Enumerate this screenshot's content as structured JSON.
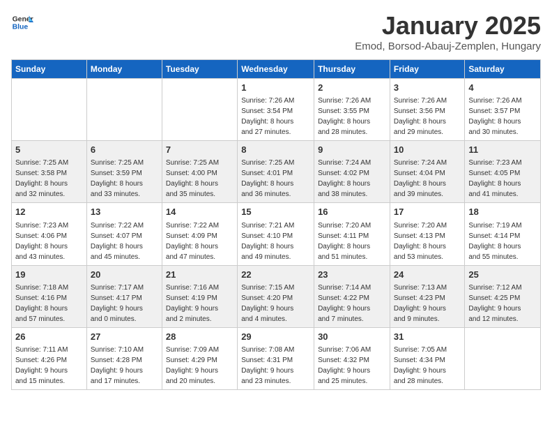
{
  "header": {
    "logo_general": "General",
    "logo_blue": "Blue",
    "month_title": "January 2025",
    "location": "Emod, Borsod-Abauj-Zemplen, Hungary"
  },
  "weekdays": [
    "Sunday",
    "Monday",
    "Tuesday",
    "Wednesday",
    "Thursday",
    "Friday",
    "Saturday"
  ],
  "weeks": [
    [
      {
        "day": "",
        "info": ""
      },
      {
        "day": "",
        "info": ""
      },
      {
        "day": "",
        "info": ""
      },
      {
        "day": "1",
        "info": "Sunrise: 7:26 AM\nSunset: 3:54 PM\nDaylight: 8 hours\nand 27 minutes."
      },
      {
        "day": "2",
        "info": "Sunrise: 7:26 AM\nSunset: 3:55 PM\nDaylight: 8 hours\nand 28 minutes."
      },
      {
        "day": "3",
        "info": "Sunrise: 7:26 AM\nSunset: 3:56 PM\nDaylight: 8 hours\nand 29 minutes."
      },
      {
        "day": "4",
        "info": "Sunrise: 7:26 AM\nSunset: 3:57 PM\nDaylight: 8 hours\nand 30 minutes."
      }
    ],
    [
      {
        "day": "5",
        "info": "Sunrise: 7:25 AM\nSunset: 3:58 PM\nDaylight: 8 hours\nand 32 minutes."
      },
      {
        "day": "6",
        "info": "Sunrise: 7:25 AM\nSunset: 3:59 PM\nDaylight: 8 hours\nand 33 minutes."
      },
      {
        "day": "7",
        "info": "Sunrise: 7:25 AM\nSunset: 4:00 PM\nDaylight: 8 hours\nand 35 minutes."
      },
      {
        "day": "8",
        "info": "Sunrise: 7:25 AM\nSunset: 4:01 PM\nDaylight: 8 hours\nand 36 minutes."
      },
      {
        "day": "9",
        "info": "Sunrise: 7:24 AM\nSunset: 4:02 PM\nDaylight: 8 hours\nand 38 minutes."
      },
      {
        "day": "10",
        "info": "Sunrise: 7:24 AM\nSunset: 4:04 PM\nDaylight: 8 hours\nand 39 minutes."
      },
      {
        "day": "11",
        "info": "Sunrise: 7:23 AM\nSunset: 4:05 PM\nDaylight: 8 hours\nand 41 minutes."
      }
    ],
    [
      {
        "day": "12",
        "info": "Sunrise: 7:23 AM\nSunset: 4:06 PM\nDaylight: 8 hours\nand 43 minutes."
      },
      {
        "day": "13",
        "info": "Sunrise: 7:22 AM\nSunset: 4:07 PM\nDaylight: 8 hours\nand 45 minutes."
      },
      {
        "day": "14",
        "info": "Sunrise: 7:22 AM\nSunset: 4:09 PM\nDaylight: 8 hours\nand 47 minutes."
      },
      {
        "day": "15",
        "info": "Sunrise: 7:21 AM\nSunset: 4:10 PM\nDaylight: 8 hours\nand 49 minutes."
      },
      {
        "day": "16",
        "info": "Sunrise: 7:20 AM\nSunset: 4:11 PM\nDaylight: 8 hours\nand 51 minutes."
      },
      {
        "day": "17",
        "info": "Sunrise: 7:20 AM\nSunset: 4:13 PM\nDaylight: 8 hours\nand 53 minutes."
      },
      {
        "day": "18",
        "info": "Sunrise: 7:19 AM\nSunset: 4:14 PM\nDaylight: 8 hours\nand 55 minutes."
      }
    ],
    [
      {
        "day": "19",
        "info": "Sunrise: 7:18 AM\nSunset: 4:16 PM\nDaylight: 8 hours\nand 57 minutes."
      },
      {
        "day": "20",
        "info": "Sunrise: 7:17 AM\nSunset: 4:17 PM\nDaylight: 9 hours\nand 0 minutes."
      },
      {
        "day": "21",
        "info": "Sunrise: 7:16 AM\nSunset: 4:19 PM\nDaylight: 9 hours\nand 2 minutes."
      },
      {
        "day": "22",
        "info": "Sunrise: 7:15 AM\nSunset: 4:20 PM\nDaylight: 9 hours\nand 4 minutes."
      },
      {
        "day": "23",
        "info": "Sunrise: 7:14 AM\nSunset: 4:22 PM\nDaylight: 9 hours\nand 7 minutes."
      },
      {
        "day": "24",
        "info": "Sunrise: 7:13 AM\nSunset: 4:23 PM\nDaylight: 9 hours\nand 9 minutes."
      },
      {
        "day": "25",
        "info": "Sunrise: 7:12 AM\nSunset: 4:25 PM\nDaylight: 9 hours\nand 12 minutes."
      }
    ],
    [
      {
        "day": "26",
        "info": "Sunrise: 7:11 AM\nSunset: 4:26 PM\nDaylight: 9 hours\nand 15 minutes."
      },
      {
        "day": "27",
        "info": "Sunrise: 7:10 AM\nSunset: 4:28 PM\nDaylight: 9 hours\nand 17 minutes."
      },
      {
        "day": "28",
        "info": "Sunrise: 7:09 AM\nSunset: 4:29 PM\nDaylight: 9 hours\nand 20 minutes."
      },
      {
        "day": "29",
        "info": "Sunrise: 7:08 AM\nSunset: 4:31 PM\nDaylight: 9 hours\nand 23 minutes."
      },
      {
        "day": "30",
        "info": "Sunrise: 7:06 AM\nSunset: 4:32 PM\nDaylight: 9 hours\nand 25 minutes."
      },
      {
        "day": "31",
        "info": "Sunrise: 7:05 AM\nSunset: 4:34 PM\nDaylight: 9 hours\nand 28 minutes."
      },
      {
        "day": "",
        "info": ""
      }
    ]
  ]
}
